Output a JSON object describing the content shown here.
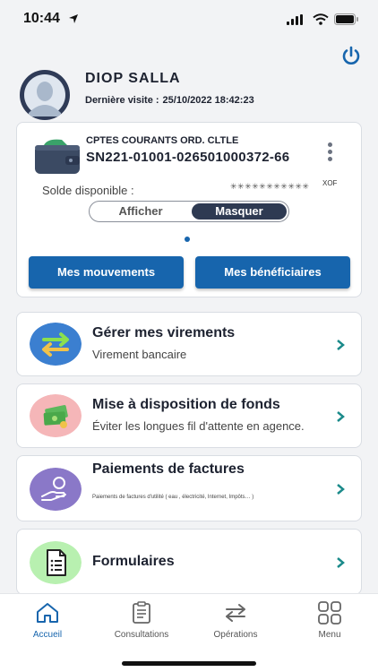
{
  "status_bar": {
    "time": "10:44"
  },
  "user": {
    "name": "DIOP  SALLA",
    "last_visit_label": "Dernière visite :",
    "last_visit_value": "25/10/2022 18:42:23"
  },
  "account": {
    "type": "CPTES COURANTS ORD. CLTLE",
    "number": "SN221-01001-026501000372-66",
    "balance_label": "Solde disponible :",
    "balance_masked": "✳✳✳✳✳✳✳✳✳✳✳",
    "currency": "XOF",
    "toggle": {
      "show_label": "Afficher",
      "hide_label": "Masquer",
      "selected": "Masquer"
    },
    "buttons": {
      "movements": "Mes mouvements",
      "beneficiaries": "Mes bénéficiaires"
    }
  },
  "menu": [
    {
      "title": "Gérer mes virements",
      "subtitle": "Virement bancaire",
      "icon": "transfer-arrows-icon",
      "color": "#3b7fd0"
    },
    {
      "title": "Mise à disposition de fonds",
      "subtitle": "Éviter les longues fil d'attente en agence.",
      "icon": "cash-money-icon",
      "color": "#f5b6b8"
    },
    {
      "title": "Paiements de factures",
      "subtitle": "Paiements de factures d'utilité ( eau , électricité, Internet, Impôts… )",
      "icon": "hand-payment-icon",
      "color": "#8a78c8"
    },
    {
      "title": "Formulaires",
      "subtitle": "",
      "icon": "document-form-icon",
      "color": "#b8f0b0"
    }
  ],
  "tabs": [
    {
      "label": "Accueil",
      "icon": "home-icon",
      "active": true
    },
    {
      "label": "Consultations",
      "icon": "clipboard-icon",
      "active": false
    },
    {
      "label": "Opérations",
      "icon": "swap-arrows-icon",
      "active": false
    },
    {
      "label": "Menu",
      "icon": "grid-icon",
      "active": false
    }
  ],
  "colors": {
    "accent": "#1765ad",
    "chevron": "#1a8a8a",
    "toggle_active": "#2e3a52"
  }
}
